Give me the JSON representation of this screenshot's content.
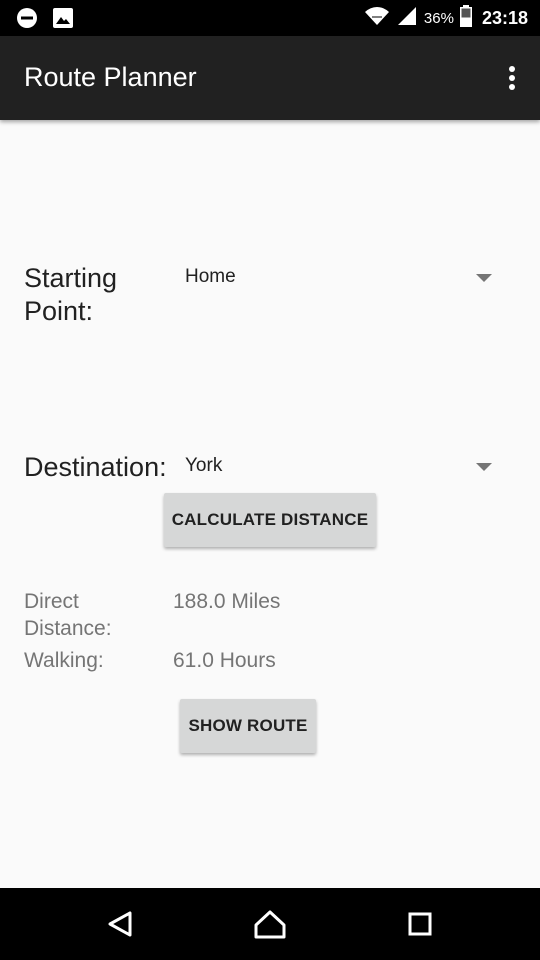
{
  "status_bar": {
    "battery_percent": "36%",
    "time": "23:18",
    "icons": [
      "dnd-icon",
      "image-icon",
      "wifi-icon",
      "signal-icon",
      "battery-icon"
    ]
  },
  "app_bar": {
    "title": "Route Planner",
    "overflow_icon": "more-vert-icon"
  },
  "form": {
    "starting_point_label": "Starting Point:",
    "starting_point_line1": "Starting",
    "starting_point_line2": "Point:",
    "starting_point_value": "Home",
    "destination_label": "Destination:",
    "destination_value": "York",
    "calculate_button": "CALCULATE DISTANCE"
  },
  "results": {
    "direct_distance_line1": "Direct",
    "direct_distance_line2": "Distance:",
    "direct_distance_value": "188.0 Miles",
    "walking_label": "Walking:",
    "walking_value": "61.0 Hours",
    "show_route_button": "SHOW ROUTE"
  },
  "nav_bar": {
    "icons": [
      "back-icon",
      "home-icon",
      "recents-icon"
    ]
  }
}
